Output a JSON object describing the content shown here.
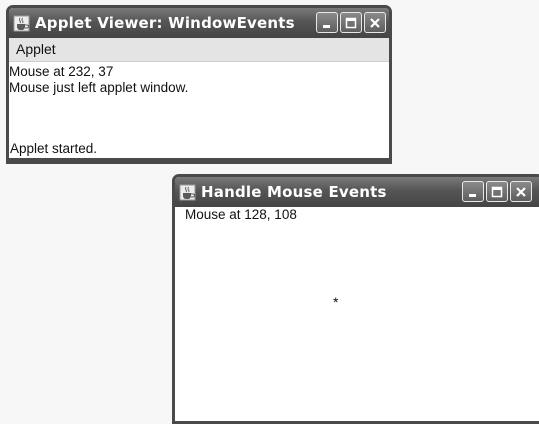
{
  "applet_viewer": {
    "title": "Applet Viewer: WindowEvents",
    "menu_label": "Applet",
    "lines": [
      "Mouse at 232, 37",
      "Mouse just left applet window."
    ],
    "status": "Applet started."
  },
  "mouse_window": {
    "title": "Handle Mouse Events",
    "text": "Mouse at 128, 108",
    "cursor_mark": "*"
  },
  "icons": {
    "app": "java-cup-icon",
    "minimize": "minimize-icon",
    "maximize": "maximize-icon",
    "close": "close-icon"
  }
}
